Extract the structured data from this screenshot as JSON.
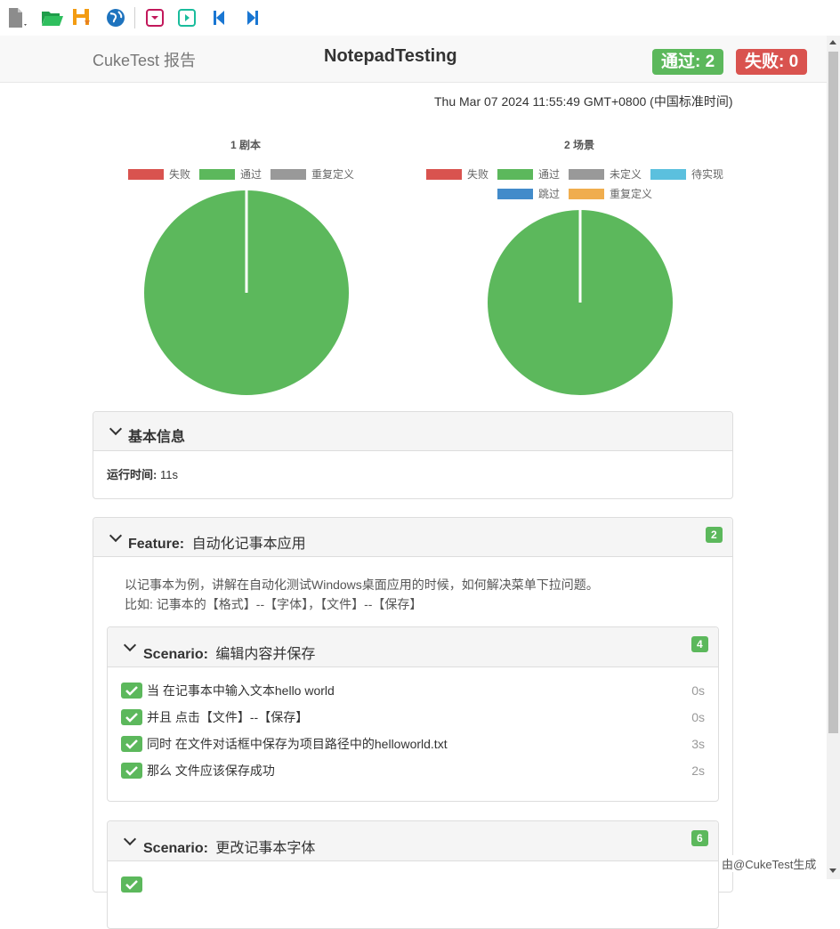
{
  "toolbar": {
    "icons": [
      "new-file-icon",
      "open-folder-icon",
      "save-icon",
      "globe-icon",
      "collapse-icon",
      "expand-icon",
      "previous-icon",
      "next-icon"
    ]
  },
  "header": {
    "brand": "CukeTest 报告",
    "title": "NotepadTesting",
    "passed_badge": "通过: 2",
    "failed_badge": "失败: 0"
  },
  "timestamp": "Thu Mar 07 2024 11:55:49 GMT+0800 (中国标准时间)",
  "charts": [
    {
      "title": "1 剧本",
      "legend": [
        {
          "label": "失败",
          "color": "#d9534f"
        },
        {
          "label": "通过",
          "color": "#5cb85c"
        },
        {
          "label": "重复定义",
          "color": "#999999"
        }
      ]
    },
    {
      "title": "2 场景",
      "legend": [
        {
          "label": "失败",
          "color": "#d9534f"
        },
        {
          "label": "通过",
          "color": "#5cb85c"
        },
        {
          "label": "未定义",
          "color": "#999999"
        },
        {
          "label": "待实现",
          "color": "#5bc0de"
        },
        {
          "label": "跳过",
          "color": "#428bca"
        },
        {
          "label": "重复定义",
          "color": "#f0ad4e"
        }
      ]
    }
  ],
  "chart_data": [
    {
      "type": "pie",
      "title": "1 剧本",
      "labels": [
        "失败",
        "通过",
        "重复定义"
      ],
      "values": [
        0,
        1,
        0
      ],
      "legend_position": "top"
    },
    {
      "type": "pie",
      "title": "2 场景",
      "labels": [
        "失败",
        "通过",
        "未定义",
        "待实现",
        "跳过",
        "重复定义"
      ],
      "values": [
        0,
        2,
        0,
        0,
        0,
        0
      ],
      "legend_position": "top"
    }
  ],
  "basic_info": {
    "heading": "基本信息",
    "runtime_label": "运行时间:",
    "runtime_value": "11s"
  },
  "feature": {
    "keyword": "Feature:",
    "name": "自动化记事本应用",
    "count": "2",
    "description_line1": "以记事本为例，讲解在自动化测试Windows桌面应用的时候，如何解决菜单下拉问题。",
    "description_line2": "比如: 记事本的【格式】--【字体】，【文件】--【保存】",
    "scenarios": [
      {
        "keyword": "Scenario:",
        "name": "编辑内容并保存",
        "count": "4",
        "steps": [
          {
            "text": "当 在记事本中输入文本hello world",
            "duration": "0s"
          },
          {
            "text": "并且 点击【文件】--【保存】",
            "duration": "0s"
          },
          {
            "text": "同时 在文件对话框中保存为项目路径中的helloworld.txt",
            "duration": "3s"
          },
          {
            "text": "那么 文件应该保存成功",
            "duration": "2s"
          }
        ]
      },
      {
        "keyword": "Scenario:",
        "name": "更改记事本字体",
        "count": "6"
      }
    ]
  },
  "footer_note": "由@CukeTest生成"
}
